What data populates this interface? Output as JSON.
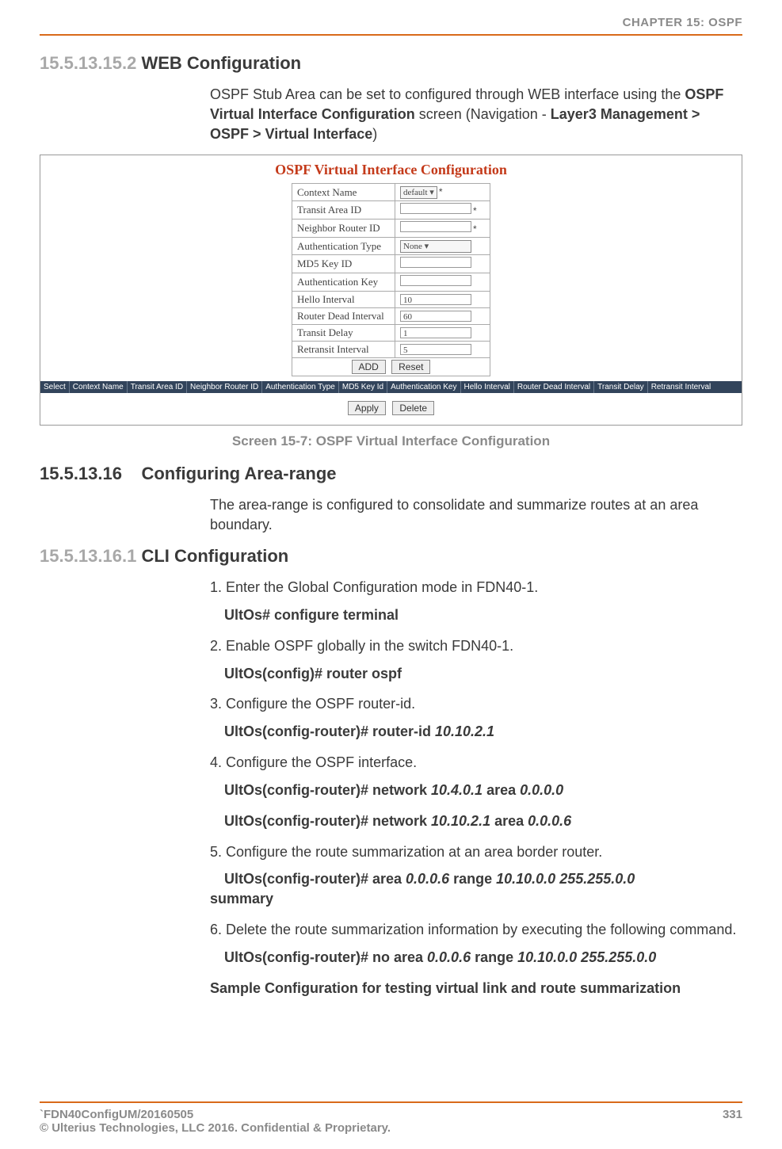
{
  "header": {
    "chapter": "CHAPTER 15: OSPF"
  },
  "sec_a": {
    "num": "15.5.13.15.2",
    "title": "WEB Configuration",
    "para_pre": "OSPF Stub Area can be set to configured through WEB interface using the ",
    "para_b1": "OSPF Virtual Interface Configuration",
    "para_mid": " screen (Navigation - ",
    "para_b2": "Layer3 Management > OSPF  >  Virtual Interface",
    "para_post": ")"
  },
  "shot": {
    "title": "OSPF Virtual Interface Configuration",
    "rows": {
      "context_name": {
        "label": "Context Name",
        "value": "default"
      },
      "transit_area": {
        "label": "Transit Area ID",
        "value": ""
      },
      "neighbor_router": {
        "label": "Neighbor Router ID",
        "value": ""
      },
      "auth_type": {
        "label": "Authentication Type",
        "value": "None"
      },
      "md5_key": {
        "label": "MD5 Key ID",
        "value": ""
      },
      "auth_key": {
        "label": "Authentication Key",
        "value": ""
      },
      "hello": {
        "label": "Hello Interval",
        "value": "10"
      },
      "dead": {
        "label": "Router Dead Interval",
        "value": "60"
      },
      "transit_delay": {
        "label": "Transit Delay",
        "value": "1"
      },
      "retransit": {
        "label": "Retransit Interval",
        "value": "5"
      }
    },
    "btns": {
      "add": "ADD",
      "reset": "Reset",
      "apply": "Apply",
      "delete": "Delete"
    },
    "cols": [
      "Select",
      "Context Name",
      "Transit Area ID",
      "Neighbor Router ID",
      "Authentication Type",
      "MD5 Key Id",
      "Authentication Key",
      "Hello Interval",
      "Router Dead Interval",
      "Transit Delay",
      "Retransit Interval"
    ]
  },
  "caption": "Screen 15-7: OSPF Virtual Interface Configuration",
  "sec_b": {
    "num": "15.5.13.16",
    "title": "Configuring Area-range",
    "para": "The area-range is configured to consolidate and summarize routes at an area boundary."
  },
  "sec_c": {
    "num": "15.5.13.16.1",
    "title": "CLI Configuration",
    "steps": {
      "s1": "1. Enter the Global Configuration mode in FDN40-1.",
      "c1": "UltOs# configure terminal",
      "s2": "2. Enable OSPF globally in the switch FDN40-1.",
      "c2": "UltOs(config)# router ospf",
      "s3": "3. Configure the OSPF router-id.",
      "c3a": "UltOs(config-router)# router-id ",
      "c3b": "10.10.2.1",
      "s4": "4. Configure the OSPF interface.",
      "c4a_a": "UltOs(config-router)# network ",
      "c4a_b": "10.4.0.1",
      "c4a_c": " area ",
      "c4a_d": "0.0.0.0",
      "c4b_a": "UltOs(config-router)# network ",
      "c4b_b": "10.10.2.1",
      "c4b_c": " area ",
      "c4b_d": "0.0.0.6",
      "s5": "5. Configure the route summarization at an area border router.",
      "c5a": "UltOs(config-router)# area ",
      "c5b": "0.0.0.6",
      "c5c": " range ",
      "c5d": "10.10.0.0 255.255.0.0",
      "c5e": "summary",
      "s6": "6. Delete the route summarization information by executing the following command.",
      "c6a": "UltOs(config-router)# no area ",
      "c6b": "0.0.0.6",
      "c6c": " range ",
      "c6d": "10.10.0.0 255.255.0.0",
      "sample": "Sample Configuration for testing virtual link and route summarization"
    }
  },
  "footer": {
    "left1": "`FDN40ConfigUM/20160505",
    "left2": "© Ulterius Technologies, LLC 2016. Confidential & Proprietary.",
    "right": "331"
  }
}
